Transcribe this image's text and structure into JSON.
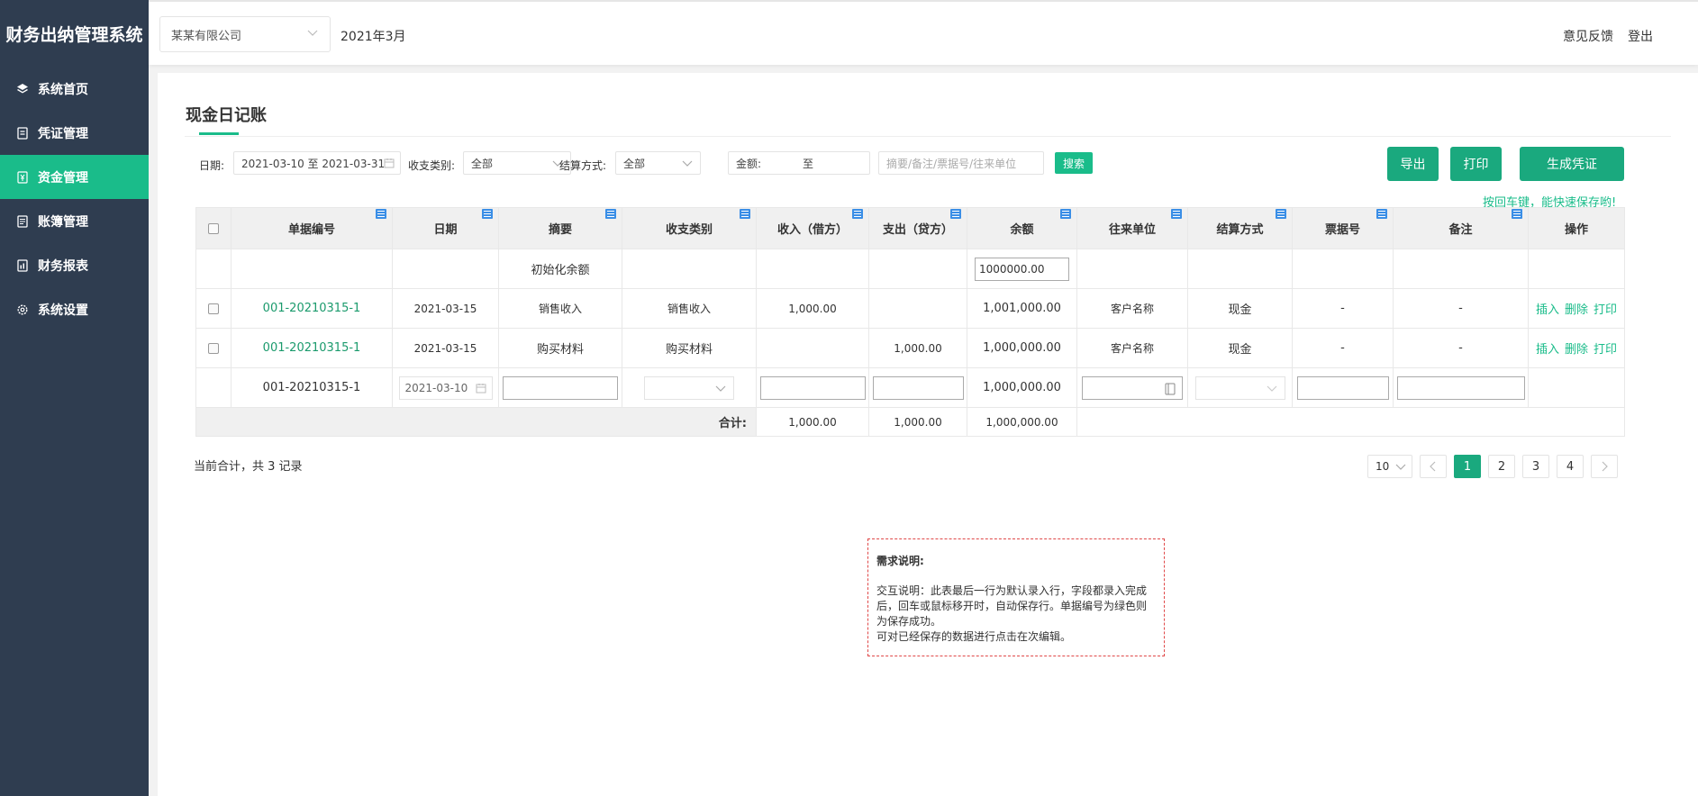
{
  "app": {
    "brand": "财务出纳管理系统"
  },
  "sidebar": {
    "items": [
      {
        "label": "系统首页",
        "icon": "layers-icon"
      },
      {
        "label": "凭证管理",
        "icon": "voucher-icon"
      },
      {
        "label": "资金管理",
        "icon": "yen-icon",
        "active": true
      },
      {
        "label": "账簿管理",
        "icon": "ledger-icon"
      },
      {
        "label": "财务报表",
        "icon": "report-icon"
      },
      {
        "label": "系统设置",
        "icon": "gear-icon"
      }
    ]
  },
  "header": {
    "company": "某某有限公司",
    "month": "2021年3月",
    "feedback": "意见反馈",
    "logout": "登出"
  },
  "page": {
    "title": "现金日记账",
    "filters": {
      "date_label": "日期:",
      "date_value": "2021-03-10 至 2021-03-31",
      "type_label": "收支类别:",
      "type_value": "全部",
      "settle_label": "结算方式:",
      "settle_value": "全部",
      "amount_label": "金额:",
      "amount_to": "至",
      "keyword_placeholder": "摘要/备注/票据号/往来单位",
      "search_label": "搜索"
    },
    "actions": {
      "export": "导出",
      "print": "打印",
      "voucher": "生成凭证"
    },
    "hint": "按回车键，能快速保存哟!"
  },
  "table": {
    "columns": [
      "单据编号",
      "日期",
      "摘要",
      "收支类别",
      "收入（借方）",
      "支出（贷方）",
      "余额",
      "往来单位",
      "结算方式",
      "票据号",
      "备注",
      "操作"
    ],
    "init_row": {
      "summary": "初始化余额",
      "balance_input": "1000000.00"
    },
    "rows": [
      {
        "no": "001-20210315-1",
        "date": "2021-03-15",
        "summary": "销售收入",
        "category": "销售收入",
        "income": "1,000.00",
        "expense": "",
        "balance": "1,001,000.00",
        "party": "客户名称",
        "settle": "现金",
        "ticket": "-",
        "remark": "-"
      },
      {
        "no": "001-20210315-1",
        "date": "2021-03-15",
        "summary": "购买材料",
        "category": "购买材料",
        "income": "",
        "expense": "1,000.00",
        "balance": "1,000,000.00",
        "party": "客户名称",
        "settle": "现金",
        "ticket": "-",
        "remark": "-"
      }
    ],
    "entry_row": {
      "no": "001-20210315-1",
      "date": "2021-03-10",
      "balance": "1,000,000.00"
    },
    "ops": {
      "insert": "插入",
      "delete": "删除",
      "print": "打印"
    },
    "total": {
      "label": "合计:",
      "income": "1,000.00",
      "expense": "1,000.00",
      "balance": "1,000,000.00"
    }
  },
  "footer": {
    "record_text": "当前合计，共 3 记录",
    "page_size": "10",
    "pages": [
      "1",
      "2",
      "3",
      "4"
    ],
    "current_page": "1"
  },
  "note": {
    "title": "需求说明:",
    "line1": "交互说明：此表最后一行为默认录入行，字段都录入完成后，回车或鼠标移开时，自动保存行。单据编号为绿色则为保存成功。",
    "line2": "可对已经保存的数据进行点击在次编辑。"
  }
}
